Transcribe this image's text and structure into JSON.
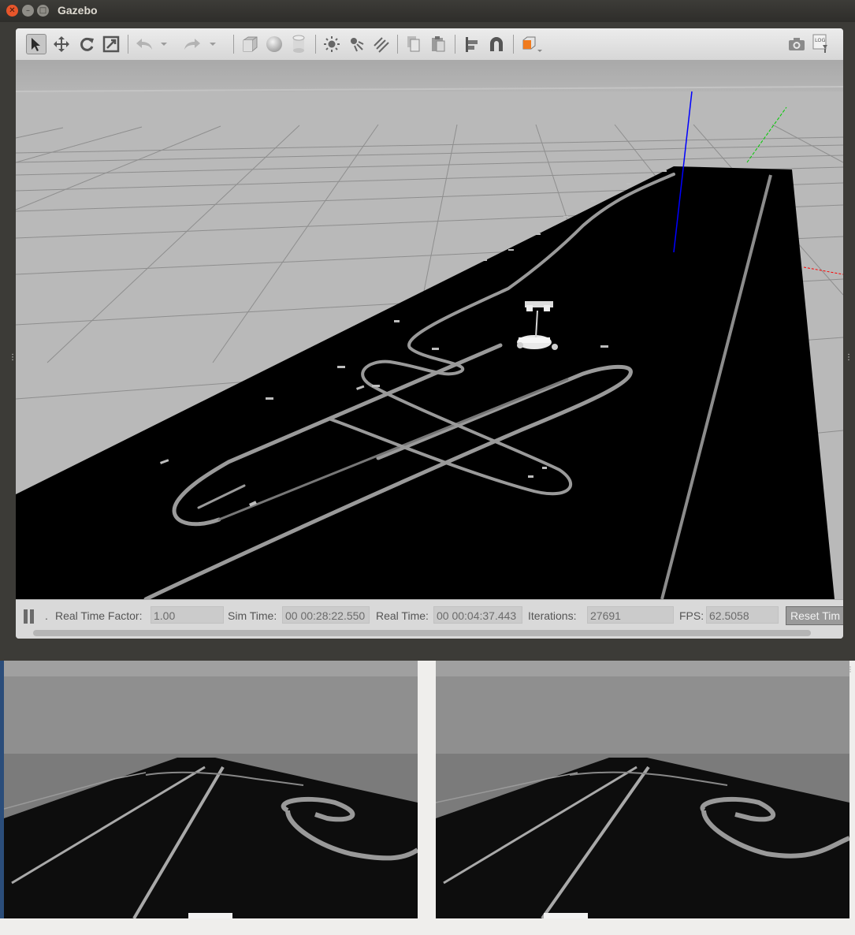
{
  "window": {
    "title": "Gazebo"
  },
  "toolbar": {
    "tools": [
      {
        "icon": "select-arrow-icon",
        "active": true
      },
      {
        "icon": "translate-icon"
      },
      {
        "icon": "rotate-icon"
      },
      {
        "icon": "scale-icon"
      },
      {
        "icon": "undo-icon"
      },
      {
        "icon": "undo-history-icon"
      },
      {
        "icon": "redo-icon"
      },
      {
        "icon": "redo-history-icon"
      },
      {
        "icon": "box-icon"
      },
      {
        "icon": "sphere-icon"
      },
      {
        "icon": "cylinder-icon"
      },
      {
        "icon": "point-light-icon"
      },
      {
        "icon": "spot-light-icon"
      },
      {
        "icon": "directional-light-icon"
      },
      {
        "icon": "copy-icon"
      },
      {
        "icon": "paste-icon"
      },
      {
        "icon": "align-icon"
      },
      {
        "icon": "snap-magnet-icon"
      },
      {
        "icon": "view-angle-icon"
      },
      {
        "icon": "screenshot-camera-icon"
      },
      {
        "icon": "log-icon"
      }
    ],
    "log_label": "LOG"
  },
  "status": {
    "real_time_factor_label": "Real Time Factor:",
    "real_time_factor": "1.00",
    "sim_time_label": "Sim Time:",
    "sim_time": "00 00:28:22.550",
    "real_time_label": "Real Time:",
    "real_time": "00 00:04:37.443",
    "iterations_label": "Iterations:",
    "iterations": "27691",
    "fps_label": "FPS:",
    "fps": "62.5058",
    "reset_label": "Reset Tim",
    "step_label": "."
  },
  "colors": {
    "viewport_ground": "#b7b7b7",
    "track_surface": "#000000",
    "axis_x": "#ff0000",
    "axis_y": "#00cc00",
    "axis_z": "#0000ff",
    "view_angle_accent": "#f07b1e"
  }
}
